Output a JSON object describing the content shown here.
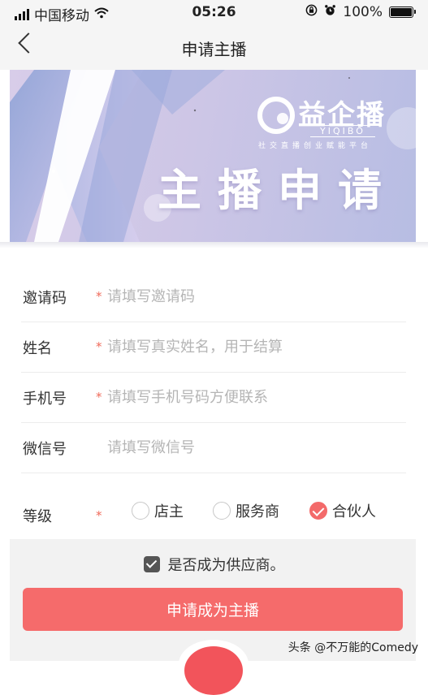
{
  "status_bar": {
    "carrier": "中国移动",
    "time": "05:26",
    "battery": "100%",
    "icons": [
      "signal-icon",
      "wifi-icon",
      "rotation-lock-icon",
      "alarm-icon",
      "battery-icon"
    ]
  },
  "nav": {
    "title": "申请主播",
    "back_icon": "chevron-left-icon"
  },
  "banner": {
    "brand_name": "益企播",
    "brand_roman": "YIQIBO",
    "brand_tagline": "社交直播创业赋能平台",
    "headline": "主播申请"
  },
  "form": {
    "fields": [
      {
        "label": "邀请码",
        "required": true,
        "placeholder": "请填写邀请码"
      },
      {
        "label": "姓名",
        "required": true,
        "placeholder": "请填写真实姓名，用于结算"
      },
      {
        "label": "手机号",
        "required": true,
        "placeholder": "请填写手机号码方便联系"
      },
      {
        "label": "微信号",
        "required": false,
        "placeholder": "请填写微信号"
      }
    ],
    "required_mark": "*",
    "grade": {
      "label": "等级",
      "required": true,
      "options": [
        "店主",
        "服务商",
        "合伙人"
      ],
      "selected": "合伙人"
    },
    "supplier_checkbox": {
      "label": "是否成为供应商。",
      "checked": true
    },
    "submit_label": "申请成为主播"
  },
  "watermark": "头条 @不万能的Comedy",
  "colors": {
    "accent": "#f56b6b",
    "required": "#f06a5a",
    "banner": "#cdc6e6",
    "background": "#f2f2f2"
  }
}
